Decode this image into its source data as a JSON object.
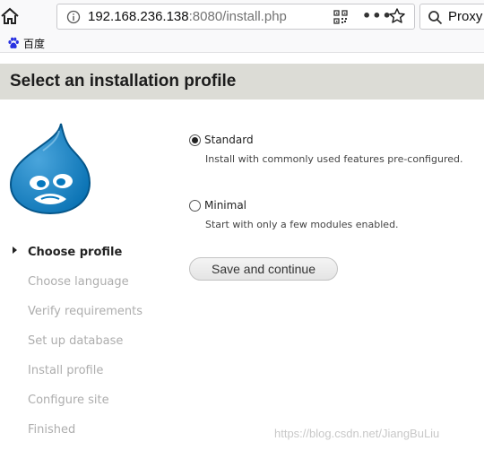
{
  "browser": {
    "url_host": "192.168.236.138",
    "url_rest": ":8080/install.php",
    "search_label": "Proxy",
    "bookmarks": [
      {
        "label": "百度"
      }
    ]
  },
  "page": {
    "title": "Select an installation profile"
  },
  "profiles": [
    {
      "label": "Standard",
      "description": "Install with commonly used features pre-configured.",
      "checked": true
    },
    {
      "label": "Minimal",
      "description": "Start with only a few modules enabled.",
      "checked": false
    }
  ],
  "save_button": "Save and continue",
  "steps": [
    {
      "label": "Choose profile",
      "active": true
    },
    {
      "label": "Choose language",
      "active": false
    },
    {
      "label": "Verify requirements",
      "active": false
    },
    {
      "label": "Set up database",
      "active": false
    },
    {
      "label": "Install profile",
      "active": false
    },
    {
      "label": "Configure site",
      "active": false
    },
    {
      "label": "Finished",
      "active": false
    }
  ],
  "watermark": "https://blog.csdn.net/JiangBuLiu",
  "colors": {
    "drupal_blue": "#0678be",
    "header_bg": "#dcdcd6",
    "step_inactive": "#adadad"
  }
}
